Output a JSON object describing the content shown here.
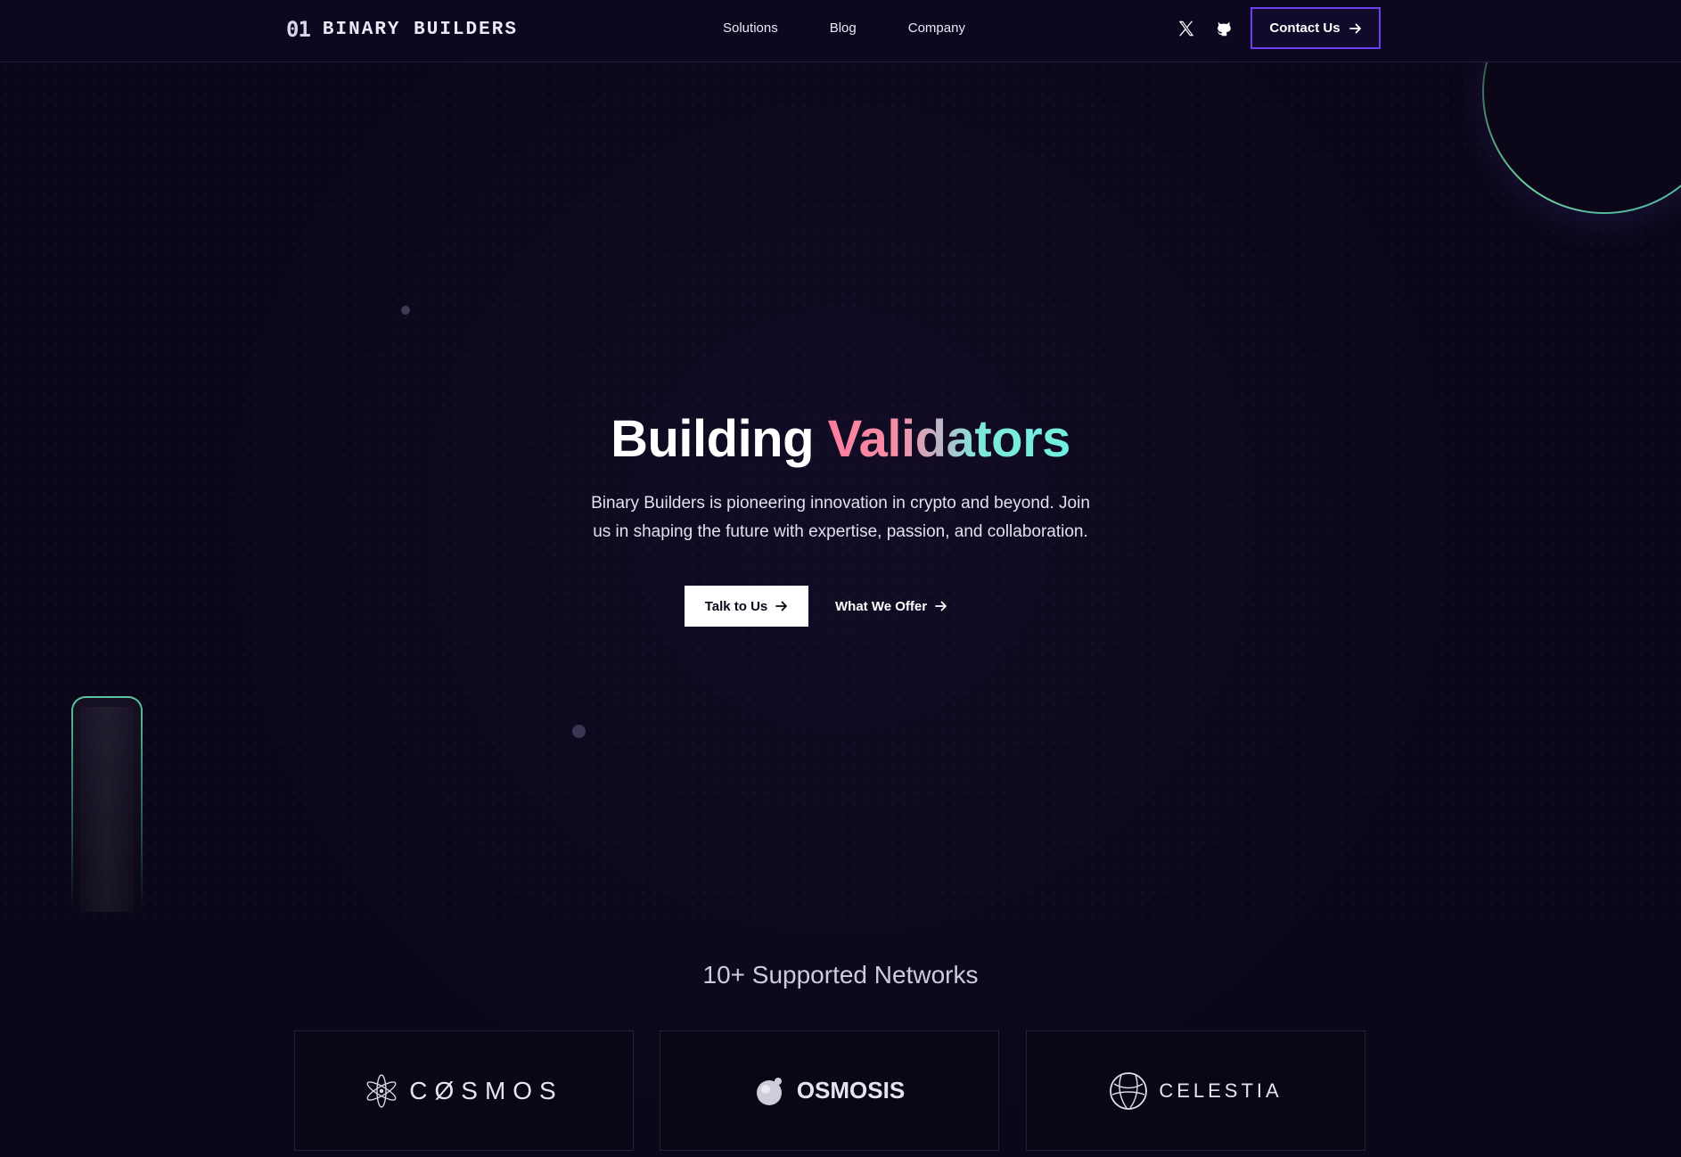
{
  "nav": {
    "logo_mark": "01",
    "logo_text": "BINARY BUILDERS",
    "links": [
      "Solutions",
      "Blog",
      "Company"
    ],
    "social_icons": [
      "x-icon",
      "github-icon"
    ],
    "contact_label": "Contact Us"
  },
  "hero": {
    "title_plain": "Building",
    "title_gradient": "Validators",
    "subtitle_line1": "Binary Builders is pioneering innovation in crypto and beyond. Join",
    "subtitle_line2": "us in shaping the future with expertise, passion, and collaboration.",
    "primary_cta": "Talk to Us",
    "secondary_cta": "What We Offer",
    "gradient_colors": [
      "#ff7c9e",
      "#b7bbc8",
      "#6ff0e0"
    ]
  },
  "networks": {
    "title": "10+ Supported Networks",
    "items": [
      {
        "name": "CØSMOS",
        "icon": "atom-icon"
      },
      {
        "name": "OSMOSIS",
        "icon": "osmosis-planet-icon"
      },
      {
        "name": "CELESTIA",
        "icon": "celestia-globe-icon"
      }
    ]
  },
  "colors": {
    "background": "#0b0718",
    "accent_border": "#6d3ff2",
    "ring_green": "#6fd39c"
  }
}
